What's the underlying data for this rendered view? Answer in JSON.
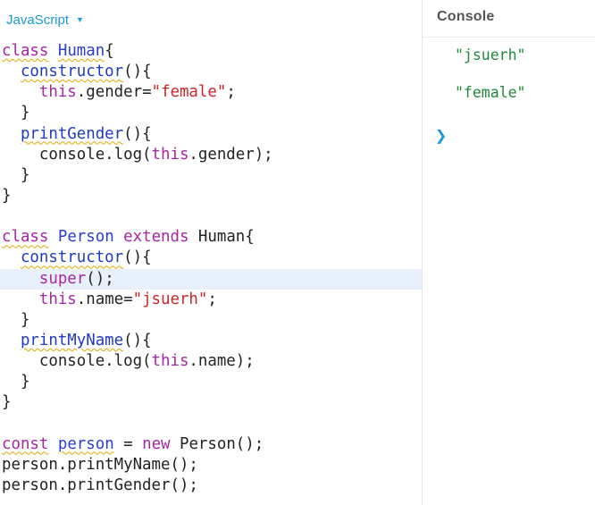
{
  "editor": {
    "language": "JavaScript",
    "lines": [
      [
        {
          "t": "class",
          "c": "kw",
          "sq": true
        },
        {
          "t": " "
        },
        {
          "t": "Human",
          "c": "cls",
          "sq": true
        },
        {
          "t": "{"
        }
      ],
      [
        {
          "t": "  "
        },
        {
          "t": "constructor",
          "c": "fn",
          "sq": true
        },
        {
          "t": "(){"
        }
      ],
      [
        {
          "t": "    "
        },
        {
          "t": "this",
          "c": "kw"
        },
        {
          "t": ".gender="
        },
        {
          "t": "\"female\"",
          "c": "str"
        },
        {
          "t": ";"
        }
      ],
      [
        {
          "t": "  }"
        }
      ],
      [
        {
          "t": "  "
        },
        {
          "t": "printGender",
          "c": "fn",
          "sq": true
        },
        {
          "t": "(){"
        }
      ],
      [
        {
          "t": "    console.log("
        },
        {
          "t": "this",
          "c": "kw"
        },
        {
          "t": ".gender);"
        }
      ],
      [
        {
          "t": "  }"
        }
      ],
      [
        {
          "t": "}"
        }
      ],
      [
        {
          "t": ""
        }
      ],
      [
        {
          "t": "class",
          "c": "kw",
          "sq": true
        },
        {
          "t": " "
        },
        {
          "t": "Person",
          "c": "cls"
        },
        {
          "t": " "
        },
        {
          "t": "extends",
          "c": "kw"
        },
        {
          "t": " Human{"
        }
      ],
      [
        {
          "t": "  "
        },
        {
          "t": "constructor",
          "c": "fn",
          "sq": true
        },
        {
          "t": "(){"
        }
      ],
      [
        {
          "t": "    "
        },
        {
          "t": "super",
          "c": "kw"
        },
        {
          "t": "();"
        }
      ],
      [
        {
          "t": "    "
        },
        {
          "t": "this",
          "c": "kw"
        },
        {
          "t": ".name="
        },
        {
          "t": "\"jsuerh\"",
          "c": "str"
        },
        {
          "t": ";"
        }
      ],
      [
        {
          "t": "  }"
        }
      ],
      [
        {
          "t": "  "
        },
        {
          "t": "printMyName",
          "c": "fn",
          "sq": true
        },
        {
          "t": "(){"
        }
      ],
      [
        {
          "t": "    console.log("
        },
        {
          "t": "this",
          "c": "kw"
        },
        {
          "t": ".name);"
        }
      ],
      [
        {
          "t": "  }"
        }
      ],
      [
        {
          "t": "}"
        }
      ],
      [
        {
          "t": ""
        }
      ],
      [
        {
          "t": "const",
          "c": "kw",
          "sq": true
        },
        {
          "t": " "
        },
        {
          "t": "person",
          "c": "cls",
          "sq": true
        },
        {
          "t": " = "
        },
        {
          "t": "new",
          "c": "kw"
        },
        {
          "t": " Person();"
        }
      ],
      [
        {
          "t": "person.printMyName();"
        }
      ],
      [
        {
          "t": "person.printGender();"
        }
      ]
    ],
    "active_line": 11
  },
  "console": {
    "title": "Console",
    "outputs": [
      "\"jsuerh\"",
      "\"female\""
    ],
    "prompt_symbol": "❯"
  },
  "colors": {
    "keyword": "#a626a4",
    "class_name": "#2a3fd0",
    "string": "#c8262b",
    "console_output": "#1d8a3a",
    "accent": "#1a9ad6"
  }
}
